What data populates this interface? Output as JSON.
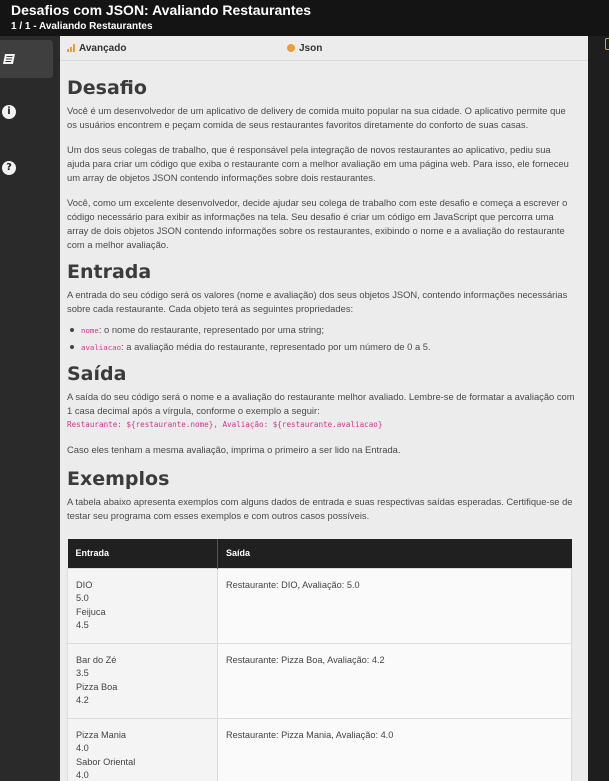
{
  "header": {
    "title": "Desafios com JSON: Avaliando Restaurantes",
    "subtitle": "1 / 1 - Avaliando Restaurantes"
  },
  "sidebar": {
    "items": [
      {
        "icon": "book-icon",
        "active": true
      },
      {
        "icon": "info-icon",
        "glyph": "i",
        "active": false
      },
      {
        "icon": "help-icon",
        "glyph": "?",
        "active": false
      }
    ]
  },
  "meta": {
    "level": "Avançado",
    "language": "Json",
    "accent_color": "#f39a36"
  },
  "desafio": {
    "title": "Desafio",
    "p1": "Você é um desenvolvedor de um aplicativo de delivery de comida muito popular na sua cidade. O aplicativo permite que os usuários encontrem e peçam comida de seus restaurantes favoritos diretamente do conforto de suas casas.",
    "p2": "Um dos seus colegas de trabalho, que é responsável pela integração de novos restaurantes ao aplicativo, pediu sua ajuda para criar um código que exiba o restaurante com a melhor avaliação em uma página web. Para isso, ele forneceu um array de objetos JSON contendo informações sobre dois restaurantes.",
    "p3": "Você, como um excelente desenvolvedor, decide ajudar seu colega de trabalho com este desafio e começa a escrever o código necessário para exibir as informações na tela. Seu desafio é criar um código em JavaScript que percorra uma array de dois objetos JSON contendo informações sobre os restaurantes, exibindo o nome e a avaliação do restaurante com a melhor avaliação."
  },
  "entrada": {
    "title": "Entrada",
    "p1": "A entrada do seu código será os valores (nome e avaliação) dos seus objetos JSON, contendo informações necessárias sobre cada restaurante. Cada objeto terá as seguintes propriedades:",
    "items": [
      {
        "code": "nome",
        "text": ": o nome do restaurante, representado por uma string;"
      },
      {
        "code": "avaliacao",
        "text": ": a avaliação média do restaurante, representado por um número de 0 a 5."
      }
    ]
  },
  "saida": {
    "title": "Saída",
    "p1": "A saída do seu código será o nome e a avaliação do restaurante melhor avaliado. Lembre-se de formatar a avaliação com 1 casa decimal após a vírgula, conforme o exemplo a seguir:",
    "code": "Restaurante: ${restaurante.nome}, Avaliação: ${restaurante.avaliacao}",
    "p2": "Caso eles tenham a mesma avaliação, imprima o primeiro a ser lido na Entrada."
  },
  "exemplos": {
    "title": "Exemplos",
    "p1": "A tabela abaixo apresenta exemplos com alguns dados de entrada e suas respectivas saídas esperadas. Certifique-se de testar seu programa com esses exemplos e com outros casos possíveis.",
    "headers": [
      "Entrada",
      "Saída"
    ],
    "rows": [
      {
        "input": [
          "DIO",
          "5.0",
          "Feijuca",
          "4.5"
        ],
        "output": "Restaurante: DIO, Avaliação: 5.0"
      },
      {
        "input": [
          "Bar do Zé",
          "3.5",
          "Pizza Boa",
          "4.2"
        ],
        "output": "Restaurante: Pizza Boa, Avaliação: 4.2"
      },
      {
        "input": [
          "Pizza Mania",
          "4.0",
          "Sabor Oriental",
          "4.0"
        ],
        "output": "Restaurante: Pizza Mania, Avaliação: 4.0"
      }
    ]
  }
}
